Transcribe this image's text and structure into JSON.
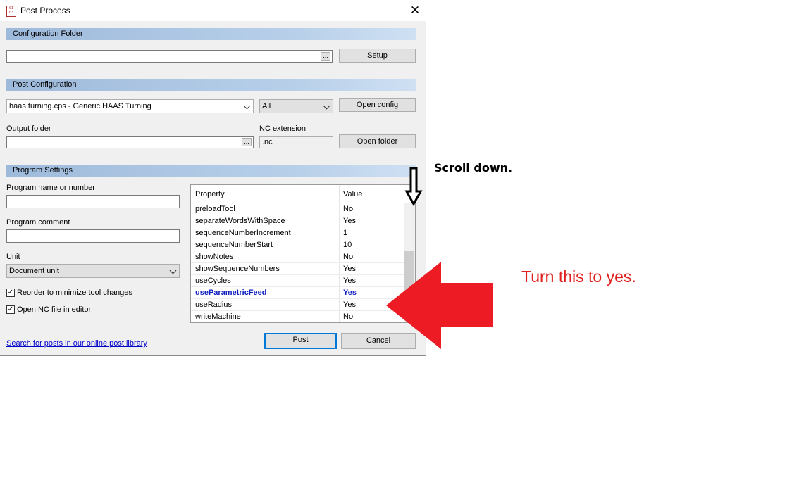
{
  "window": {
    "title": "Post Process",
    "icon": "post-process-app-icon",
    "icon_text": "01 03"
  },
  "config_folder": {
    "section_title": "Configuration Folder",
    "path_value": "",
    "browse_label": "...",
    "setup_label": "Setup"
  },
  "post_config": {
    "section_title": "Post Configuration",
    "post_selected": "haas turning.cps - Generic HAAS Turning",
    "filter_selected": "All",
    "open_config_label": "Open config",
    "output_folder_label": "Output folder",
    "output_folder_value": "",
    "browse_label": "...",
    "nc_extension_label": "NC extension",
    "nc_extension_value": ".nc",
    "open_folder_label": "Open folder"
  },
  "program_settings": {
    "section_title": "Program Settings",
    "program_name_label": "Program name or number",
    "program_name_value": "",
    "program_comment_label": "Program comment",
    "program_comment_value": "",
    "unit_label": "Unit",
    "unit_selected": "Document unit",
    "reorder_label": "Reorder to minimize tool changes",
    "reorder_checked": true,
    "open_nc_label": "Open NC file in editor",
    "open_nc_checked": true
  },
  "properties": {
    "header_property": "Property",
    "header_value": "Value",
    "rows": [
      {
        "property": "preloadTool",
        "value": "No"
      },
      {
        "property": "separateWordsWithSpace",
        "value": "Yes"
      },
      {
        "property": "sequenceNumberIncrement",
        "value": "1"
      },
      {
        "property": "sequenceNumberStart",
        "value": "10"
      },
      {
        "property": "showNotes",
        "value": "No"
      },
      {
        "property": "showSequenceNumbers",
        "value": "Yes"
      },
      {
        "property": "useCycles",
        "value": "Yes"
      },
      {
        "property": "useParametricFeed",
        "value": "Yes",
        "modified": true
      },
      {
        "property": "useRadius",
        "value": "Yes"
      },
      {
        "property": "writeMachine",
        "value": "No"
      }
    ],
    "highlight_color": "#1020c0"
  },
  "footer": {
    "library_link": "Search for posts in our online post library",
    "post_label": "Post",
    "cancel_label": "Cancel"
  },
  "annotations": {
    "scroll_hint": "Scroll down.",
    "turn_yes_hint": "Turn this to yes.",
    "arrow_color": "#ed1c24",
    "text_color": "#e0201d"
  }
}
